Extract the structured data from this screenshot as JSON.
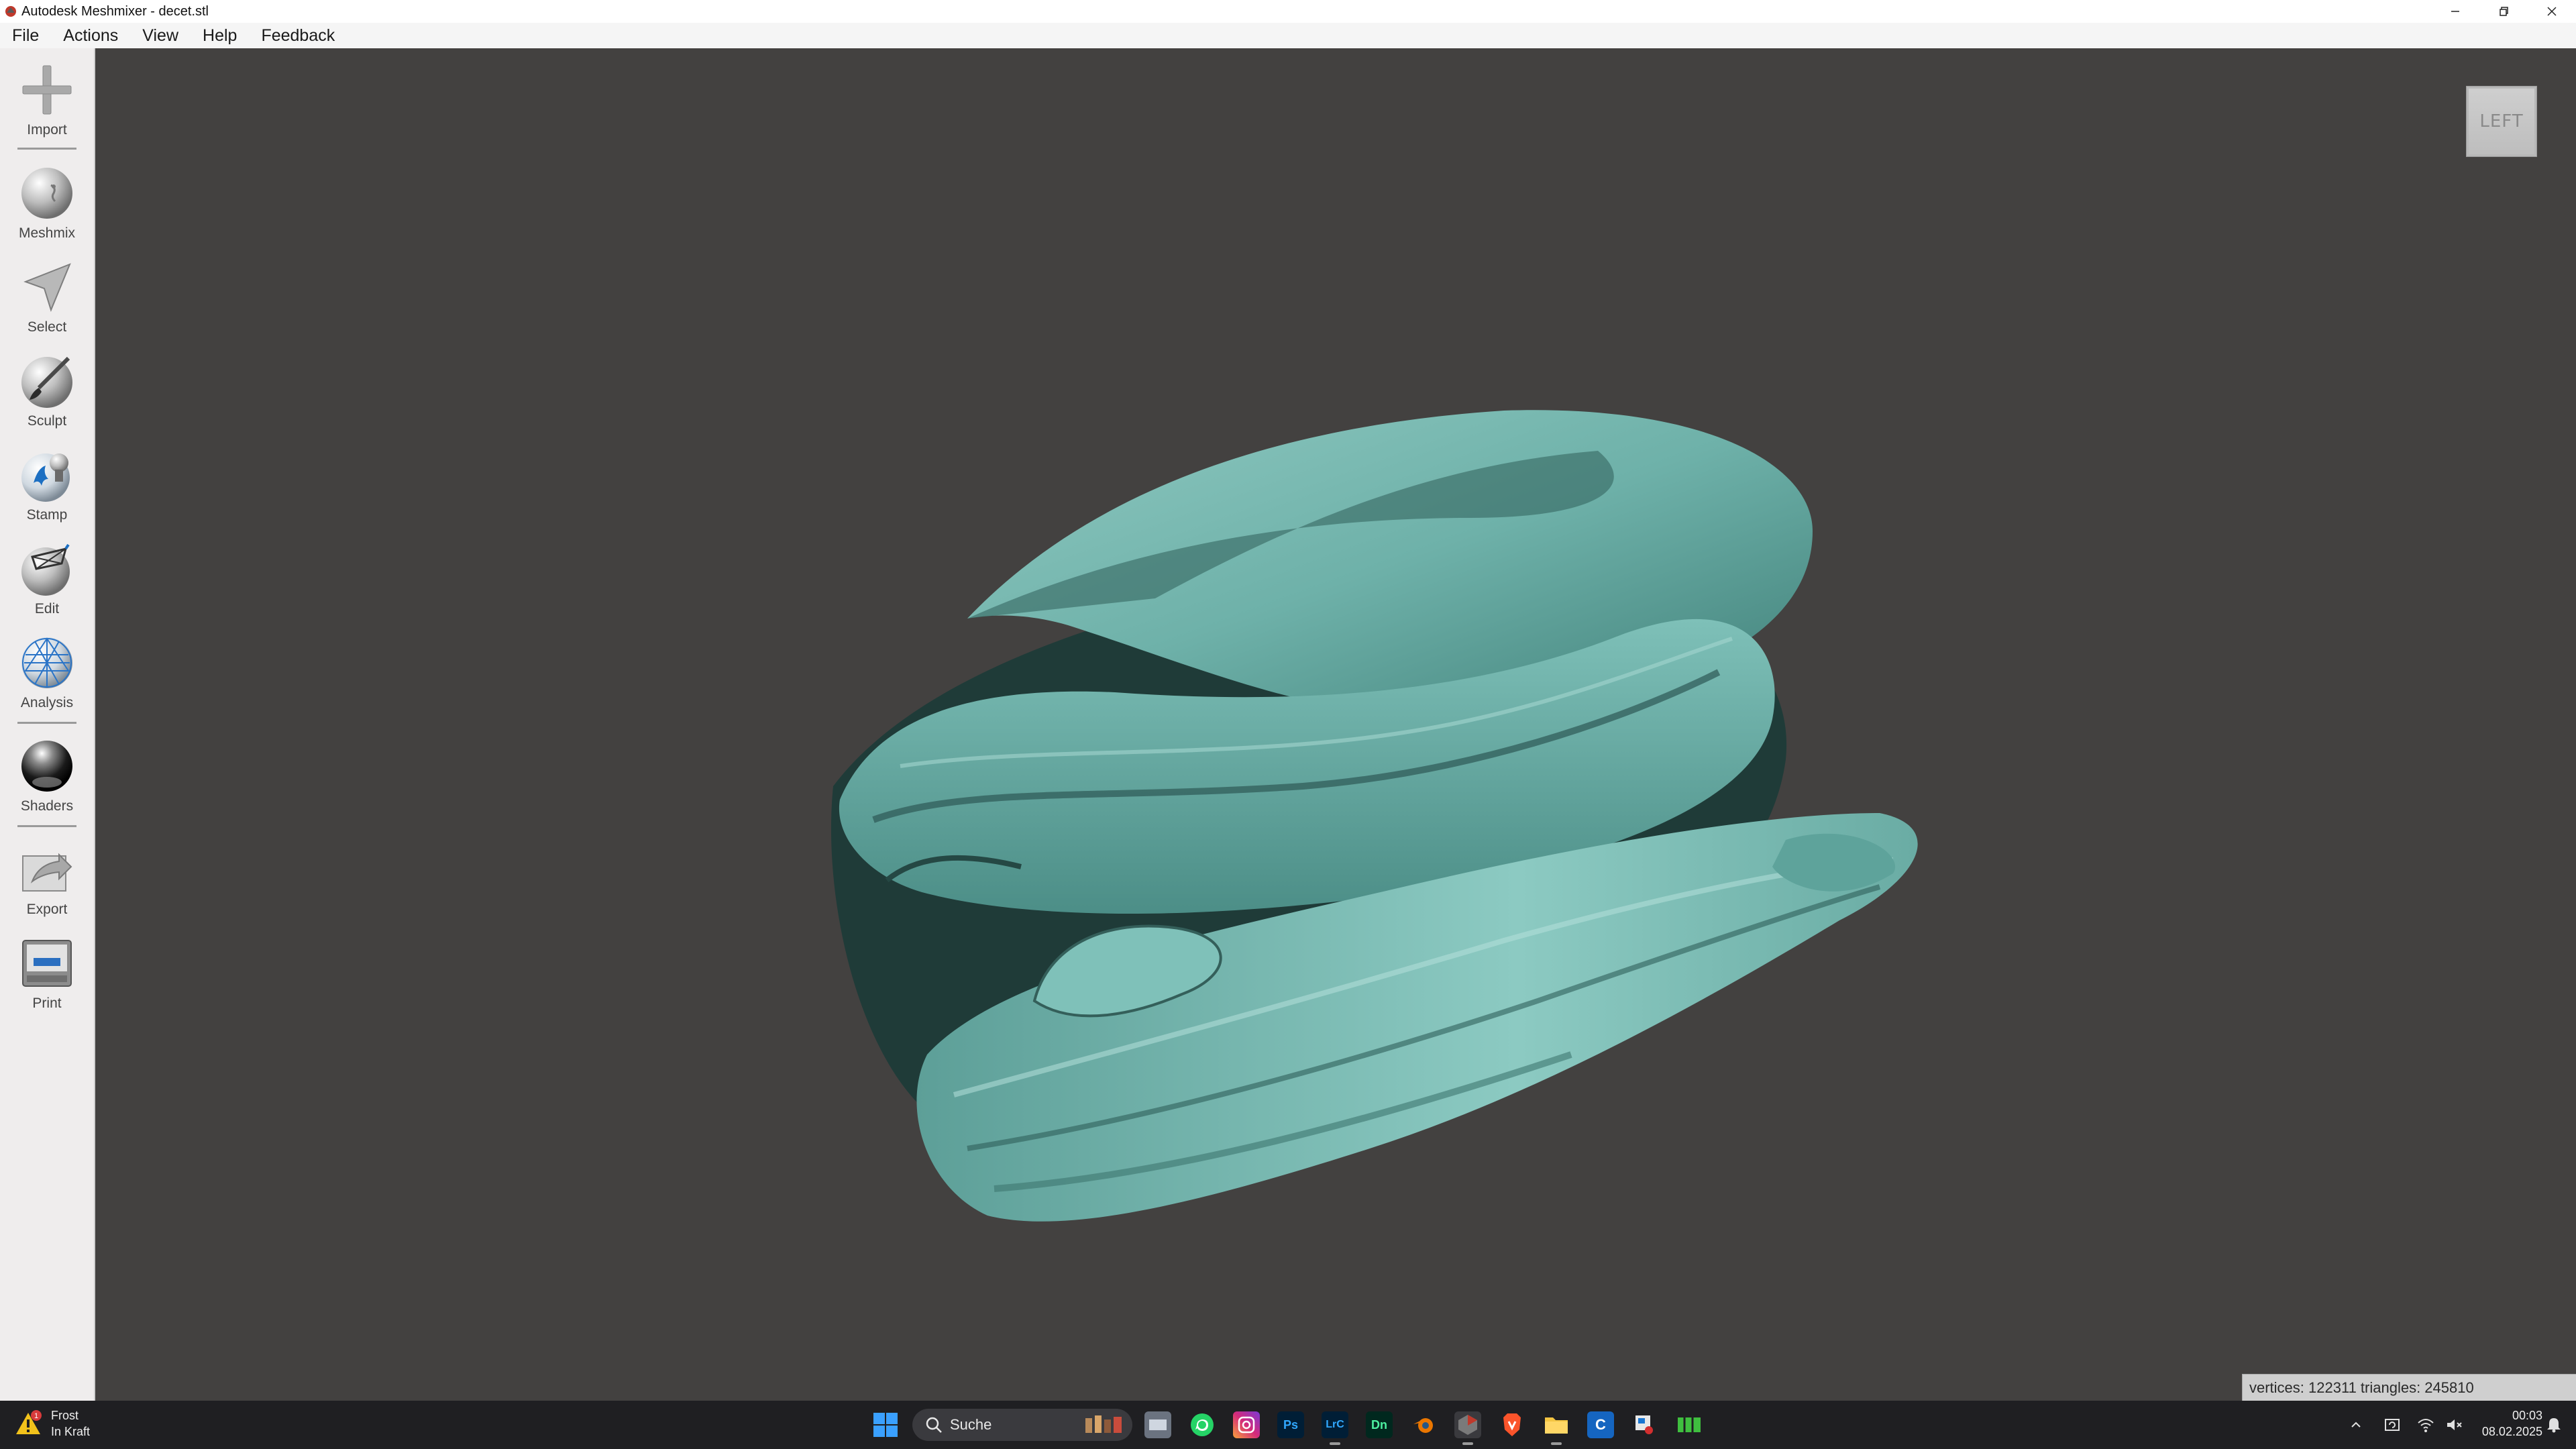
{
  "window": {
    "title": "Autodesk Meshmixer - decet.stl",
    "controls": [
      "minimize-icon",
      "restore-icon",
      "close-icon"
    ]
  },
  "menu": {
    "items": [
      "File",
      "Actions",
      "View",
      "Help",
      "Feedback"
    ]
  },
  "sidebar": {
    "tools": [
      {
        "label": "Import",
        "icon": "plus-icon"
      },
      {
        "label": "Meshmix",
        "icon": "meshmix-sphere-icon"
      },
      {
        "label": "Select",
        "icon": "arrow-cursor-icon"
      },
      {
        "label": "Sculpt",
        "icon": "brush-sphere-icon"
      },
      {
        "label": "Stamp",
        "icon": "stamp-sphere-icon"
      },
      {
        "label": "Edit",
        "icon": "edit-sphere-icon"
      },
      {
        "label": "Analysis",
        "icon": "mesh-sphere-icon"
      },
      {
        "label": "Shaders",
        "icon": "shiny-sphere-icon"
      },
      {
        "label": "Export",
        "icon": "export-folder-icon"
      },
      {
        "label": "Print",
        "icon": "printer-icon"
      }
    ]
  },
  "viewport": {
    "view_cube_label": "LEFT",
    "stats": "vertices: 122311 triangles: 245810",
    "model_color": "#6fb3ab",
    "background_color": "#434140"
  },
  "taskbar": {
    "weather": {
      "name": "Frost",
      "status": "In Kraft",
      "badge": "1"
    },
    "search_placeholder": "Suche",
    "apps": [
      {
        "name": "task-view",
        "label": ""
      },
      {
        "name": "whatsapp",
        "label": ""
      },
      {
        "name": "instagram",
        "label": ""
      },
      {
        "name": "photoshop",
        "label": "Ps"
      },
      {
        "name": "lightroom-classic",
        "label": "LrC"
      },
      {
        "name": "dimension",
        "label": "Dn"
      },
      {
        "name": "blender",
        "label": ""
      },
      {
        "name": "meshmixer",
        "label": ""
      },
      {
        "name": "brave",
        "label": ""
      },
      {
        "name": "file-explorer",
        "label": ""
      },
      {
        "name": "capture",
        "label": "C"
      },
      {
        "name": "snipping-tool",
        "label": ""
      },
      {
        "name": "spreadsheet",
        "label": ""
      }
    ],
    "clock": {
      "time": "00:03",
      "date": "08.02.2025"
    }
  }
}
